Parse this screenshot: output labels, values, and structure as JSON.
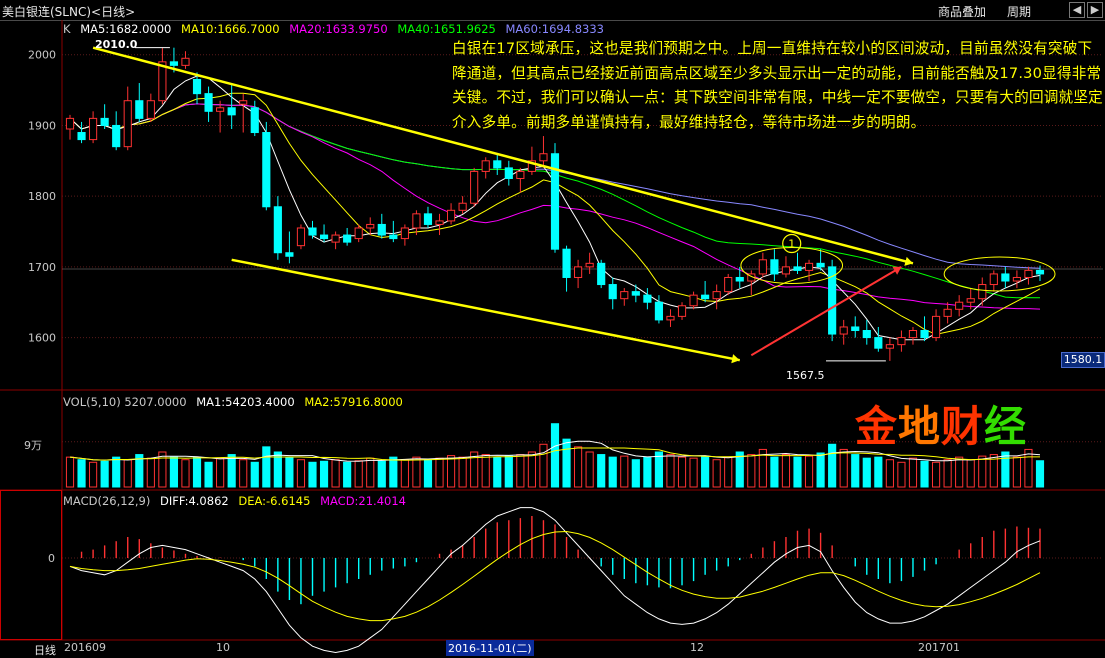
{
  "window": {
    "title": "美白银连(SLNC)<日线>",
    "overlay_button": "商品叠加",
    "period_button": "周期",
    "nav_prev": "◀",
    "nav_next": "▶"
  },
  "price_legend": {
    "k": "K",
    "ma5": "MA5:1682.0000",
    "ma10": "MA10:1666.7000",
    "ma20": "MA20:1633.9750",
    "ma40": "MA40:1651.9625",
    "ma60": "MA60:1694.8333"
  },
  "vol_legend": {
    "vol": "VOL(5,10)  5207.0000",
    "ma1": "MA1:54203.4000",
    "ma2": "MA2:57916.8000"
  },
  "macd_legend": {
    "macd": "MACD(26,12,9)",
    "diff": "DIFF:4.0862",
    "dea": "DEA:-6.6145",
    "macd_val": "MACD:21.4014"
  },
  "annotation": "白银在17区域承压，这也是我们预期之中。上周一直维持在较小的区间波动，目前虽然没有突破下降通道，但其高点已经接近前面高点区域至少多头显示出一定的动能，目前能否触及17.30显得非常关键。不过，我们可以确认一点：其下跌空间非常有限，中线一定不要做空，只要有大的回调就坚定介入多单。前期多单谨慎持有，最好维持轻仓，等待市场进一步的明朗。",
  "brand": {
    "text": [
      "金",
      "地",
      "财",
      "经"
    ],
    "colors": [
      "#ff3300",
      "#ff7700",
      "#ff3300",
      "#33dd00"
    ]
  },
  "axis": {
    "bottom_label": "日线",
    "last_price_tag": "1580.1",
    "high_label": "2010.0",
    "low_label": "1567.5",
    "circle_label": "1",
    "vol_tick": "9万",
    "macd_tick": "0",
    "x_ticks": [
      "201609",
      "10",
      "2016-11-01(二)",
      "12",
      "201701"
    ]
  },
  "colors": {
    "up": "#ff3232",
    "down": "#00ffff",
    "ma5": "#ffffff",
    "ma10": "#ffff00",
    "ma20": "#ff00ff",
    "ma40": "#00ff00",
    "ma60": "#8888ff",
    "trend": "#ffff00",
    "uptrend": "#ff3333"
  },
  "chart_data": {
    "type": "candlestick",
    "ylim": [
      1540,
      2035
    ],
    "yticks": [
      1600,
      1700,
      1800,
      1900,
      2000
    ],
    "trendlines": [
      {
        "points": [
          [
            2,
            2010
          ],
          [
            73,
            1705
          ]
        ]
      },
      {
        "points": [
          [
            14,
            1710
          ],
          [
            58,
            1568
          ]
        ]
      },
      {
        "points": [
          [
            59,
            1575
          ],
          [
            72,
            1700
          ]
        ]
      }
    ],
    "ohlc": [
      [
        1895,
        1915,
        1880,
        1910
      ],
      [
        1890,
        1905,
        1875,
        1880
      ],
      [
        1880,
        1920,
        1875,
        1910
      ],
      [
        1910,
        1930,
        1895,
        1900
      ],
      [
        1900,
        1920,
        1865,
        1870
      ],
      [
        1870,
        1955,
        1865,
        1935
      ],
      [
        1935,
        1960,
        1905,
        1910
      ],
      [
        1910,
        1945,
        1905,
        1935
      ],
      [
        1935,
        2010,
        1930,
        1990
      ],
      [
        1990,
        2010,
        1975,
        1985
      ],
      [
        1985,
        2005,
        1980,
        1995
      ],
      [
        1965,
        1975,
        1930,
        1945
      ],
      [
        1945,
        1955,
        1905,
        1920
      ],
      [
        1920,
        1935,
        1890,
        1925
      ],
      [
        1925,
        1960,
        1895,
        1915
      ],
      [
        1930,
        1945,
        1890,
        1935
      ],
      [
        1925,
        1935,
        1885,
        1890
      ],
      [
        1890,
        1905,
        1780,
        1785
      ],
      [
        1785,
        1800,
        1710,
        1720
      ],
      [
        1720,
        1750,
        1705,
        1715
      ],
      [
        1730,
        1760,
        1725,
        1755
      ],
      [
        1755,
        1765,
        1740,
        1745
      ],
      [
        1745,
        1760,
        1735,
        1740
      ],
      [
        1735,
        1750,
        1725,
        1745
      ],
      [
        1745,
        1755,
        1730,
        1735
      ],
      [
        1740,
        1760,
        1735,
        1755
      ],
      [
        1755,
        1770,
        1745,
        1760
      ],
      [
        1760,
        1775,
        1740,
        1745
      ],
      [
        1745,
        1765,
        1735,
        1740
      ],
      [
        1740,
        1760,
        1730,
        1755
      ],
      [
        1755,
        1780,
        1745,
        1775
      ],
      [
        1775,
        1785,
        1755,
        1760
      ],
      [
        1760,
        1775,
        1745,
        1765
      ],
      [
        1765,
        1790,
        1760,
        1780
      ],
      [
        1780,
        1800,
        1775,
        1790
      ],
      [
        1790,
        1840,
        1785,
        1835
      ],
      [
        1835,
        1855,
        1825,
        1850
      ],
      [
        1850,
        1860,
        1830,
        1840
      ],
      [
        1840,
        1850,
        1815,
        1825
      ],
      [
        1825,
        1840,
        1805,
        1835
      ],
      [
        1835,
        1870,
        1830,
        1850
      ],
      [
        1850,
        1885,
        1840,
        1860
      ],
      [
        1860,
        1875,
        1720,
        1725
      ],
      [
        1725,
        1730,
        1665,
        1685
      ],
      [
        1685,
        1710,
        1670,
        1700
      ],
      [
        1700,
        1720,
        1690,
        1705
      ],
      [
        1705,
        1710,
        1670,
        1675
      ],
      [
        1675,
        1685,
        1640,
        1655
      ],
      [
        1655,
        1670,
        1645,
        1665
      ],
      [
        1665,
        1675,
        1650,
        1660
      ],
      [
        1660,
        1670,
        1640,
        1650
      ],
      [
        1650,
        1660,
        1620,
        1625
      ],
      [
        1625,
        1640,
        1615,
        1630
      ],
      [
        1630,
        1650,
        1625,
        1645
      ],
      [
        1645,
        1665,
        1640,
        1660
      ],
      [
        1660,
        1680,
        1650,
        1655
      ],
      [
        1655,
        1675,
        1640,
        1665
      ],
      [
        1665,
        1690,
        1660,
        1685
      ],
      [
        1685,
        1700,
        1670,
        1680
      ],
      [
        1680,
        1695,
        1660,
        1690
      ],
      [
        1690,
        1720,
        1685,
        1710
      ],
      [
        1710,
        1725,
        1680,
        1690
      ],
      [
        1690,
        1715,
        1685,
        1700
      ],
      [
        1700,
        1720,
        1690,
        1695
      ],
      [
        1695,
        1710,
        1680,
        1705
      ],
      [
        1705,
        1725,
        1695,
        1700
      ],
      [
        1700,
        1710,
        1595,
        1605
      ],
      [
        1605,
        1625,
        1590,
        1615
      ],
      [
        1615,
        1630,
        1600,
        1610
      ],
      [
        1610,
        1625,
        1590,
        1600
      ],
      [
        1600,
        1615,
        1580,
        1585
      ],
      [
        1585,
        1600,
        1567,
        1590
      ],
      [
        1590,
        1610,
        1580,
        1600
      ],
      [
        1600,
        1615,
        1590,
        1610
      ],
      [
        1610,
        1630,
        1595,
        1600
      ],
      [
        1600,
        1640,
        1595,
        1630
      ],
      [
        1630,
        1650,
        1620,
        1640
      ],
      [
        1640,
        1660,
        1630,
        1650
      ],
      [
        1650,
        1670,
        1640,
        1655
      ],
      [
        1655,
        1685,
        1645,
        1675
      ],
      [
        1675,
        1695,
        1665,
        1690
      ],
      [
        1690,
        1700,
        1670,
        1680
      ],
      [
        1680,
        1695,
        1670,
        1685
      ],
      [
        1685,
        1700,
        1675,
        1695
      ],
      [
        1695,
        1702,
        1680,
        1690
      ]
    ],
    "volume": [
      6,
      5.5,
      5,
      5.2,
      6,
      5.5,
      6.5,
      5.8,
      7,
      6,
      5.5,
      6,
      5,
      5.8,
      6.5,
      5.5,
      5,
      8,
      7,
      6,
      5.5,
      5,
      5.2,
      5.5,
      5,
      5.3,
      5.8,
      5.2,
      6,
      5.5,
      6,
      5.5,
      5.8,
      6.3,
      6,
      7,
      6.5,
      6,
      6.2,
      6.5,
      7,
      8.5,
      12.5,
      9.5,
      8,
      7,
      6.5,
      6,
      6.2,
      5.5,
      6,
      7,
      6.5,
      6,
      5.8,
      6.2,
      5.5,
      6,
      7,
      6.5,
      7.5,
      6,
      6.5,
      6,
      6.2,
      6.8,
      8.5,
      7.5,
      6.5,
      5.8,
      6,
      5.5,
      5,
      5.8,
      5.2,
      5,
      5.5,
      6,
      5.5,
      6.2,
      6.5,
      7,
      6,
      7.5,
      5.3
    ],
    "macd_hist": [
      0,
      1.5,
      2,
      3,
      4,
      5,
      4.5,
      3.5,
      2.5,
      1.8,
      1,
      0.5,
      0.2,
      0.1,
      0,
      -0.5,
      -2,
      -5,
      -8,
      -10,
      -11,
      -9,
      -8,
      -7,
      -6,
      -5,
      -4,
      -3,
      -2.5,
      -2,
      -1,
      0,
      1,
      2,
      3,
      5,
      7,
      8.5,
      9,
      9.5,
      10,
      9,
      8,
      5,
      2,
      0,
      -2,
      -4,
      -5,
      -6,
      -6.5,
      -7,
      -7.2,
      -6.5,
      -5.5,
      -4,
      -3,
      -2,
      -0.5,
      1,
      2.5,
      4,
      5,
      6.5,
      7,
      6,
      3,
      0,
      -2,
      -4,
      -5,
      -6,
      -5.5,
      -4.5,
      -3,
      -1.5,
      0,
      2,
      3.5,
      5,
      6.5,
      7,
      7.5,
      7.2,
      7
    ],
    "macd_diff": [
      -2,
      -3,
      -3.5,
      -4,
      -3,
      -1,
      1,
      2.5,
      3,
      2.5,
      2,
      1,
      0,
      -1,
      -2,
      -3,
      -5,
      -8,
      -12,
      -16,
      -19,
      -21,
      -22,
      -22.5,
      -22,
      -21,
      -19,
      -17,
      -14,
      -11,
      -8,
      -5,
      -2,
      1,
      3,
      5.5,
      8,
      10,
      11,
      12,
      12,
      11,
      9,
      6,
      3,
      0,
      -3,
      -6,
      -9,
      -11,
      -13,
      -14.5,
      -15.5,
      -15.8,
      -15.5,
      -14.5,
      -13,
      -11,
      -8.5,
      -6,
      -3.5,
      -1,
      1,
      2.5,
      3,
      1.5,
      -3,
      -7,
      -10.5,
      -13,
      -14.5,
      -15.5,
      -15.5,
      -15,
      -14,
      -12.5,
      -11,
      -9,
      -7,
      -5,
      -3,
      -1,
      1.5,
      3,
      4.1
    ],
    "macd_dea": [
      -2,
      -2.5,
      -2.8,
      -3,
      -3,
      -2.8,
      -2.5,
      -2,
      -1.5,
      -1,
      -0.5,
      -0.2,
      -0.3,
      -0.6,
      -1,
      -1.5,
      -2.2,
      -3.3,
      -4.8,
      -6.6,
      -8.5,
      -10.3,
      -11.7,
      -12.9,
      -13.9,
      -14.5,
      -14.9,
      -14.9,
      -14.5,
      -13.9,
      -12.9,
      -11.6,
      -10,
      -8.2,
      -6.3,
      -4.3,
      -2.3,
      -0.3,
      1.5,
      3.2,
      4.6,
      5.6,
      6.2,
      6.3,
      5.8,
      4.9,
      3.6,
      2,
      0.2,
      -1.6,
      -3.4,
      -5,
      -6.5,
      -7.7,
      -8.6,
      -9.2,
      -9.6,
      -9.6,
      -9.3,
      -8.6,
      -7.9,
      -7,
      -6,
      -5,
      -4.1,
      -3.5,
      -3.5,
      -4.2,
      -5.3,
      -6.6,
      -7.9,
      -9.1,
      -10.1,
      -10.9,
      -11.4,
      -11.6,
      -11.5,
      -11.1,
      -10.4,
      -9.6,
      -8.6,
      -7.5,
      -6.3,
      -4.9,
      -3.5
    ]
  }
}
